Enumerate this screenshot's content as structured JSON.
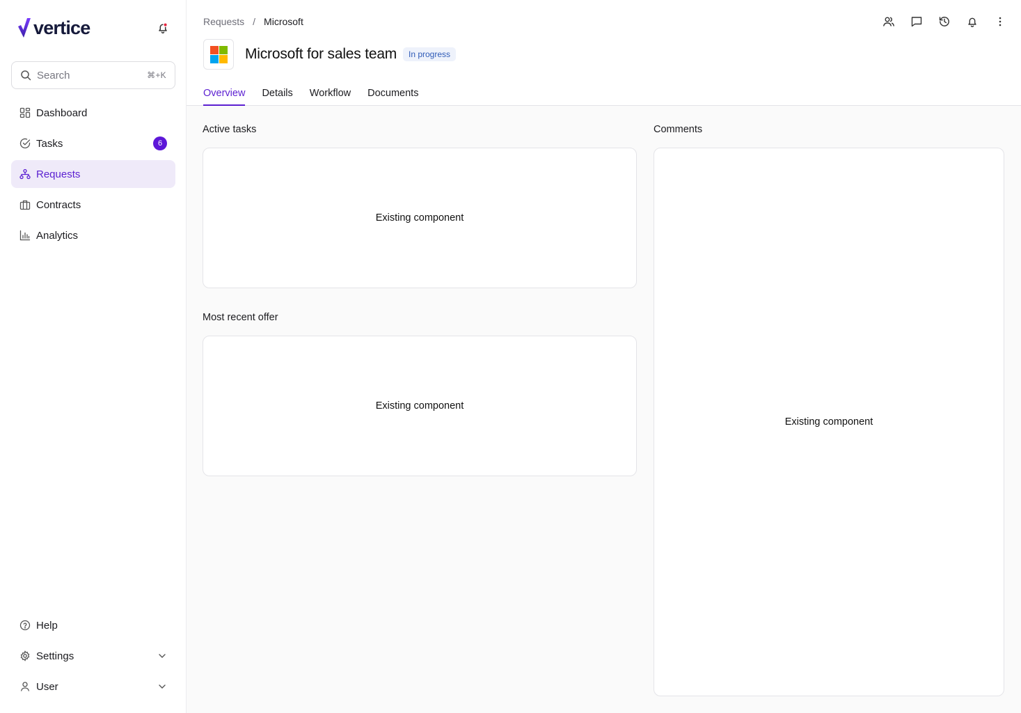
{
  "app": {
    "name": "vertice",
    "colors": {
      "accent": "#5b1fd1",
      "badge": "#5d17d8",
      "status_bg": "#eef2fb",
      "status_text": "#2f5bb7"
    }
  },
  "search": {
    "placeholder": "Search",
    "shortcut": "⌘+K"
  },
  "sidebar": {
    "items": [
      {
        "label": "Dashboard",
        "icon": "dashboard-icon"
      },
      {
        "label": "Tasks",
        "icon": "tasks-icon",
        "badge": "6"
      },
      {
        "label": "Requests",
        "icon": "requests-icon",
        "active": true
      },
      {
        "label": "Contracts",
        "icon": "contracts-icon"
      },
      {
        "label": "Analytics",
        "icon": "analytics-icon"
      }
    ],
    "bottom": [
      {
        "label": "Help",
        "icon": "help-icon"
      },
      {
        "label": "Settings",
        "icon": "gear-icon"
      },
      {
        "label": "User",
        "icon": "user-icon"
      }
    ]
  },
  "header": {
    "breadcrumb": {
      "parent": "Requests",
      "separator": "/",
      "current": "Microsoft"
    },
    "title": "Microsoft for sales team",
    "status": "In progress",
    "vendor_logo_colors": [
      "#f25022",
      "#7fba00",
      "#00a4ef",
      "#ffb900"
    ],
    "actions": [
      "people-icon",
      "comment-icon",
      "history-icon",
      "bell-icon",
      "more-vertical-icon"
    ]
  },
  "tabs": [
    {
      "label": "Overview",
      "active": true
    },
    {
      "label": "Details"
    },
    {
      "label": "Workflow"
    },
    {
      "label": "Documents"
    }
  ],
  "main": {
    "active_tasks": {
      "title": "Active tasks",
      "body": "Existing component"
    },
    "recent_offer": {
      "title": "Most recent offer",
      "body": "Existing component"
    },
    "comments": {
      "title": "Comments",
      "body": "Existing component"
    }
  }
}
